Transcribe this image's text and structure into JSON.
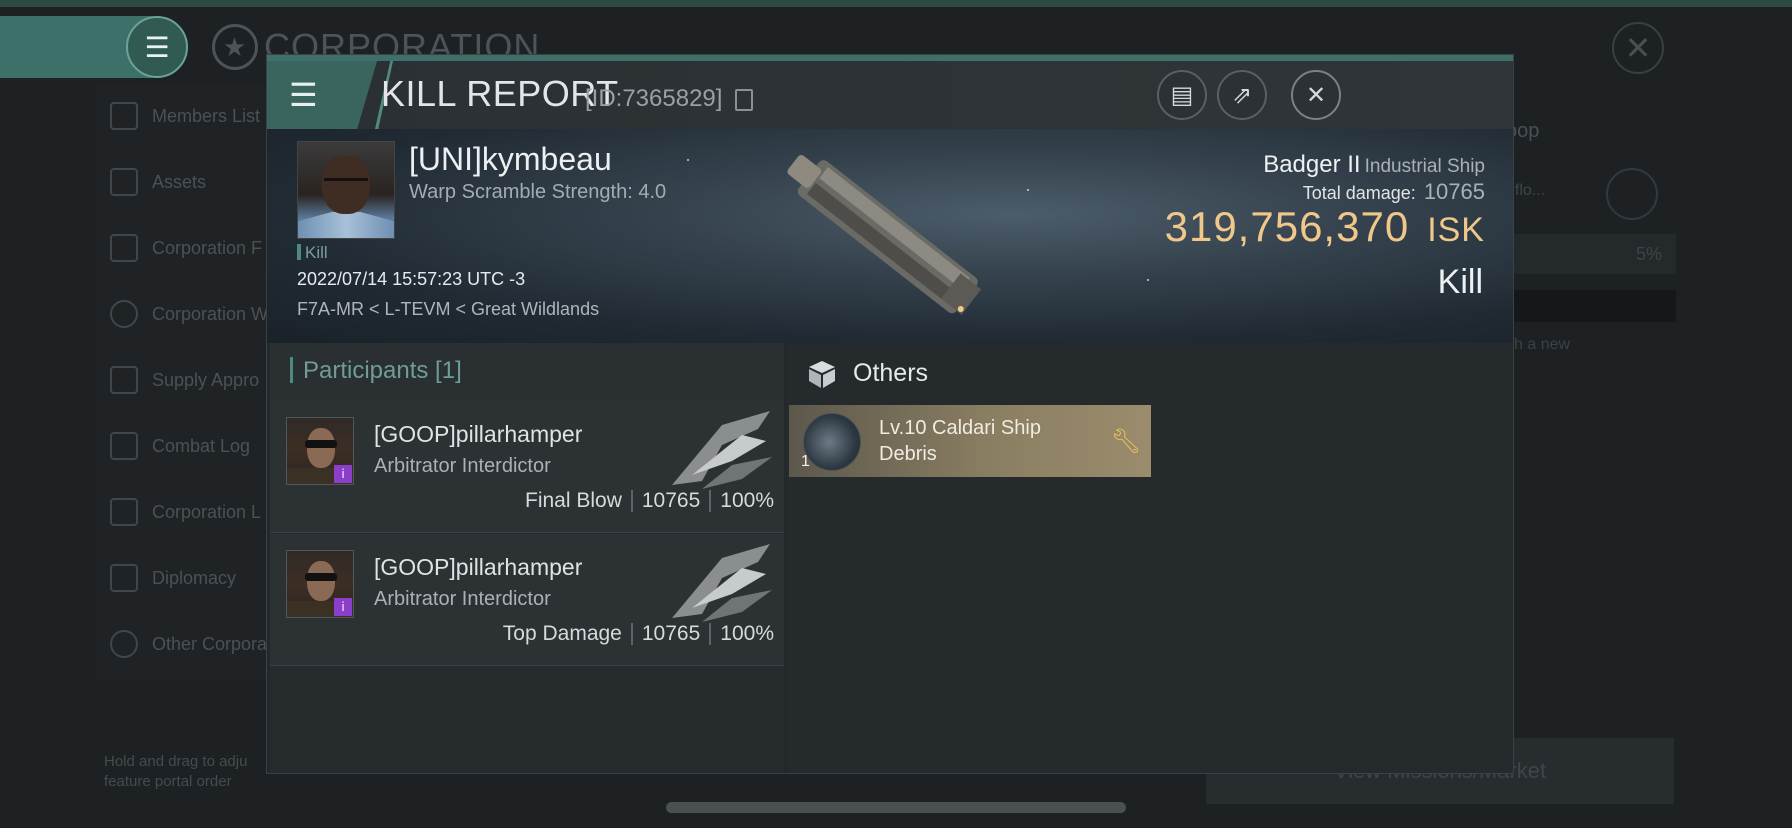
{
  "background": {
    "menu_icon": "hamburger-icon",
    "corp_title": "CORPORATION",
    "sidebar": [
      {
        "label": "Members List",
        "icon": "members-icon"
      },
      {
        "label": "Assets",
        "icon": "assets-icon"
      },
      {
        "label": "Corporation F",
        "icon": "chart-icon"
      },
      {
        "label": "Corporation W",
        "icon": "pie-icon"
      },
      {
        "label": "Supply Appro",
        "icon": "supply-icon"
      },
      {
        "label": "Combat Log",
        "icon": "combat-icon"
      },
      {
        "label": "Corporation L",
        "icon": "log-icon"
      },
      {
        "label": "Diplomacy",
        "icon": "diplomacy-icon"
      },
      {
        "label": "Other Corpora",
        "icon": "corp-icon"
      }
    ],
    "hold_text": "Hold and drag to adju feature portal order",
    "right_text_1": "oop",
    "right_text_2": "eflo...",
    "right_box": "5%",
    "right_text_3": "sh a new",
    "mission_button": "View Missions/Market"
  },
  "kill_report": {
    "title": "KILL REPORT",
    "id": "[ID:7365829]",
    "victim": {
      "name": "[UNI]kymbeau",
      "warp_scramble": "Warp Scramble Strength: 4.0",
      "tag": "Kill",
      "datetime": "2022/07/14 15:57:23 UTC -3",
      "location": "F7A-MR < L-TEVM < Great Wildlands"
    },
    "ship": {
      "name": "Badger II",
      "class": "Industrial Ship",
      "total_damage_label": "Total damage:",
      "total_damage": "10765",
      "isk_value": "319,756,370",
      "isk_unit": "ISK",
      "result": "Kill"
    },
    "participants": {
      "title": "Participants [1]",
      "rows": [
        {
          "name": "[GOOP]pillarhamper",
          "ship": "Arbitrator Interdictor",
          "role": "Final Blow",
          "damage": "10765",
          "percent": "100%"
        },
        {
          "name": "[GOOP]pillarhamper",
          "ship": "Arbitrator Interdictor",
          "role": "Top Damage",
          "damage": "10765",
          "percent": "100%"
        }
      ]
    },
    "others": {
      "title": "Others",
      "items": [
        {
          "name": "Lv.10 Caldari Ship Debris",
          "qty": "1"
        }
      ]
    }
  }
}
